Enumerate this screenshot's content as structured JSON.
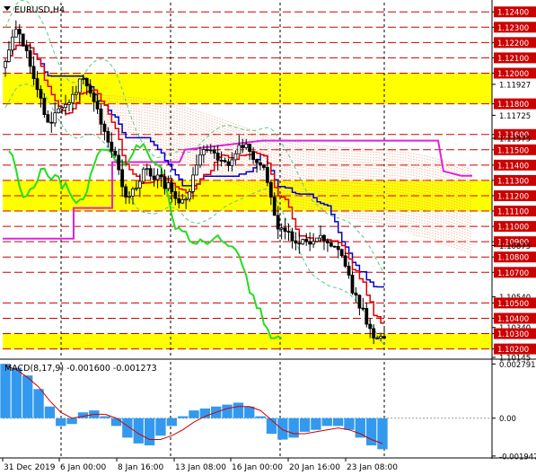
{
  "window": {
    "symbol_label": "EURUSD,H4",
    "macd_label": "MACD(8,17,9) -0.001600 -0.001273"
  },
  "colors": {
    "background": "#ffffff",
    "grid": "#000000",
    "level_line": "#cc0000",
    "level_label": "#cc0000",
    "yellow_band": "#ffff00",
    "candles": "#000000",
    "ma_fast": "#dd0000",
    "ma_slow": "#0000cc",
    "chikou": "#22dd22",
    "senkou_b": "#dd22dd",
    "cloud_dots": "#e8a080",
    "bands": "#55c88a",
    "macd_hist": "#3399ee",
    "macd_signal": "#cc0000"
  },
  "chart_data": [
    {
      "type": "line",
      "title": "EURUSD,H4",
      "y_axis_labels": [
        "1.12400",
        "1.12300",
        "1.12200",
        "1.12100",
        "1.12000",
        "1.11927",
        "1.11800",
        "1.11725",
        "1.11600",
        "1.11575",
        "1.11500",
        "1.11400",
        "1.11300",
        "1.11200",
        "1.11100",
        "1.11000",
        "1.10900",
        "1.10875",
        "1.10800",
        "1.10700",
        "1.10540",
        "1.10500",
        "1.10400",
        "1.10340",
        "1.10300",
        "1.10200",
        "1.10145"
      ],
      "highlighted_levels": [
        "1.12400",
        "1.12300",
        "1.12200",
        "1.12100",
        "1.12000",
        "1.11800",
        "1.11600",
        "1.11500",
        "1.11400",
        "1.11300",
        "1.11200",
        "1.11100",
        "1.11000",
        "1.10900",
        "1.10800",
        "1.10700",
        "1.10500",
        "1.10400",
        "1.10300",
        "1.10200"
      ],
      "yellow_zones": [
        [
          1.118,
          1.12
        ],
        [
          1.111,
          1.113
        ],
        [
          1.102,
          1.103
        ]
      ],
      "ylim": [
        1.10145,
        1.1246
      ],
      "x_tick_labels": [
        "31 Dec 2019",
        "6 Jan 00:00",
        "8 Jan 16:00",
        "13 Jan 08:00",
        "16 Jan 00:00",
        "20 Jan 16:00",
        "23 Jan 08:00"
      ],
      "series": [
        {
          "values": [
            1.121,
            1.1232,
            1.1212,
            1.119,
            1.1165,
            1.1176,
            1.1182,
            1.1197,
            1.1188,
            1.1162,
            1.1148,
            1.112,
            1.1125,
            1.1138,
            1.1132,
            1.1126,
            1.1118,
            1.1121,
            1.115,
            1.1152,
            1.114,
            1.1143,
            1.1155,
            1.1145,
            1.1136,
            1.1102,
            1.1095,
            1.1088,
            1.109,
            1.1092,
            1.1088,
            1.1082,
            1.106,
            1.1045,
            1.1028,
            1.1025
          ]
        }
      ]
    },
    {
      "type": "bar",
      "title": "MACD(8,17,9) -0.001600 -0.001273",
      "y_axis_labels": [
        "0.002791",
        "0.00",
        "-0.001947"
      ],
      "ylim": [
        -0.002,
        0.0029
      ],
      "series": [
        {
          "values": [
            0.0028,
            0.0026,
            0.0022,
            0.0015,
            0.0006,
            -0.0004,
            -0.0003,
            0.0003,
            0.0004,
            0.0001,
            -0.0004,
            -0.001,
            -0.0013,
            -0.0014,
            -0.0009,
            -0.0004,
            0.0001,
            0.0004,
            0.0005,
            0.0006,
            0.0007,
            0.0008,
            0.0006,
            0.0001,
            -0.0008,
            -0.0011,
            -0.001,
            -0.0007,
            -0.0006,
            -0.0004,
            -0.0004,
            -0.0006,
            -0.001,
            -0.0014,
            -0.0016
          ]
        },
        {
          "values": [
            0.0027,
            0.0025,
            0.0021,
            0.0016,
            0.0009,
            0.0003,
            0.0,
            0.0001,
            0.0002,
            0.0002,
            0.0,
            -0.0004,
            -0.0008,
            -0.0011,
            -0.0011,
            -0.0009,
            -0.0006,
            -0.0002,
            0.0001,
            0.0003,
            0.0005,
            0.0006,
            0.0006,
            0.0004,
            -0.0001,
            -0.0006,
            -0.0008,
            -0.0008,
            -0.0007,
            -0.0006,
            -0.0005,
            -0.0006,
            -0.0008,
            -0.0011,
            -0.0013
          ]
        }
      ]
    }
  ]
}
